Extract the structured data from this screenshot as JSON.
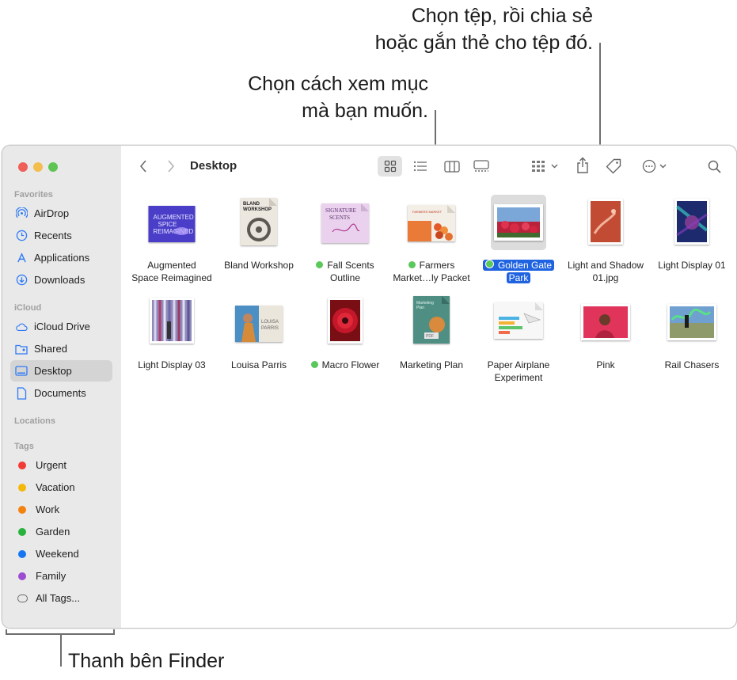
{
  "callouts": {
    "share_tag": [
      "Chọn tệp, rồi chia sẻ",
      "hoặc gắn thẻ cho tệp đó."
    ],
    "view": [
      "Chọn cách xem mục",
      "mà bạn muốn."
    ],
    "sidebar": "Thanh bên Finder"
  },
  "window": {
    "title": "Desktop"
  },
  "sidebar": {
    "favorites_label": "Favorites",
    "favorites": [
      {
        "label": "AirDrop",
        "icon": "airdrop-icon"
      },
      {
        "label": "Recents",
        "icon": "clock-icon"
      },
      {
        "label": "Applications",
        "icon": "applications-icon"
      },
      {
        "label": "Downloads",
        "icon": "download-icon"
      }
    ],
    "icloud_label": "iCloud",
    "icloud": [
      {
        "label": "iCloud Drive",
        "icon": "cloud-icon"
      },
      {
        "label": "Shared",
        "icon": "shared-folder-icon"
      },
      {
        "label": "Desktop",
        "icon": "desktop-icon",
        "selected": true
      },
      {
        "label": "Documents",
        "icon": "document-icon"
      }
    ],
    "locations_label": "Locations",
    "tags_label": "Tags",
    "tags": [
      {
        "label": "Urgent",
        "color": "#f23b35"
      },
      {
        "label": "Vacation",
        "color": "#f3b80a"
      },
      {
        "label": "Work",
        "color": "#f3830e"
      },
      {
        "label": "Garden",
        "color": "#27b33b"
      },
      {
        "label": "Weekend",
        "color": "#1676f2"
      },
      {
        "label": "Family",
        "color": "#9d4dd0"
      },
      {
        "label": "All Tags...",
        "color": ""
      }
    ]
  },
  "files": [
    {
      "line1": "Augmented",
      "line2": "Space Reimagined",
      "tag": false
    },
    {
      "line1": "Bland Workshop",
      "line2": "",
      "tag": false
    },
    {
      "line1": "Fall Scents",
      "line2": "Outline",
      "tag": true
    },
    {
      "line1": "Farmers",
      "line2": "Market…ly Packet",
      "tag": true
    },
    {
      "line1": "Golden Gate",
      "line2": "Park",
      "tag": true,
      "selected": true
    },
    {
      "line1": "Light and Shadow",
      "line2": "01.jpg",
      "tag": false
    },
    {
      "line1": "Light Display 01",
      "line2": "",
      "tag": false
    },
    {
      "line1": "Light Display 03",
      "line2": "",
      "tag": false
    },
    {
      "line1": "Louisa Parris",
      "line2": "",
      "tag": false
    },
    {
      "line1": "Macro Flower",
      "line2": "",
      "tag": true
    },
    {
      "line1": "Marketing Plan",
      "line2": "",
      "tag": false
    },
    {
      "line1": "Paper Airplane",
      "line2": "Experiment",
      "tag": false
    },
    {
      "line1": "Pink",
      "line2": "",
      "tag": false
    },
    {
      "line1": "Rail Chasers",
      "line2": "",
      "tag": false
    }
  ],
  "colors": {
    "accent": "#1f63e0",
    "tag_green": "#5bc85b",
    "sidebar_bg": "#e9e9e9"
  }
}
